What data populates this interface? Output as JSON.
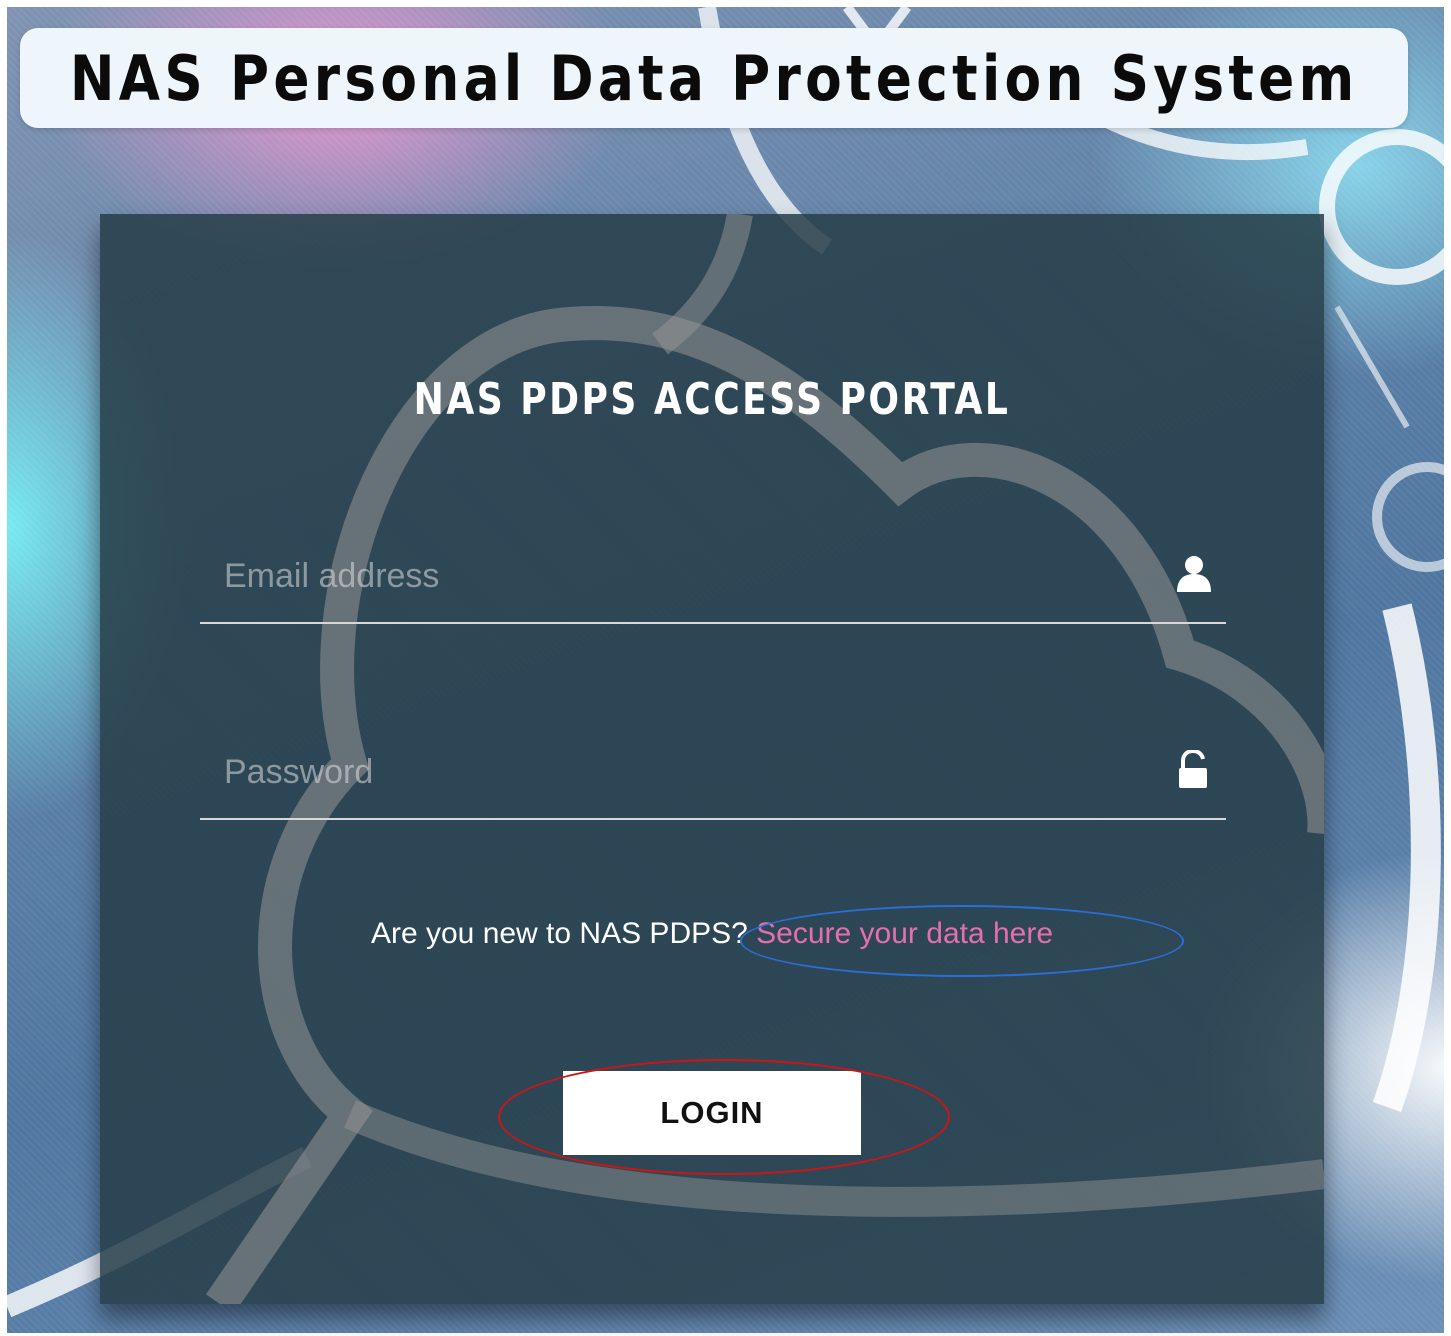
{
  "header": {
    "title": "NAS Personal Data Protection System"
  },
  "portal": {
    "title": "NAS PDPS ACCESS PORTAL",
    "email": {
      "value": "",
      "placeholder": "Email address",
      "icon": "user-icon"
    },
    "password": {
      "value": "",
      "placeholder": "Password",
      "icon": "unlock-icon"
    },
    "signup": {
      "prompt": "Are you new to NAS PDPS?",
      "link_label": "Secure your data here"
    },
    "login_label": "LOGIN"
  },
  "annotations": [
    {
      "shape": "ellipse",
      "color": "#2a6fd6",
      "target": "signup-link"
    },
    {
      "shape": "ellipse",
      "color": "#d01414",
      "target": "login-button"
    }
  ],
  "colors": {
    "link": "#e46fae",
    "panel": "#263e48",
    "banner": "#eef5fb"
  }
}
